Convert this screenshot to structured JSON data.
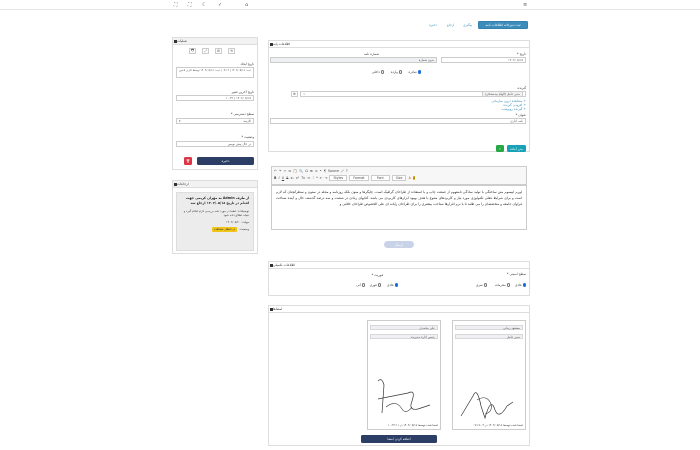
{
  "topbar": {
    "menu_icon": "≡",
    "icons": [
      "⛶",
      "⛶",
      "☾",
      "✓",
      "⌂"
    ]
  },
  "header": {
    "primary_button": "ثبت دبیرخانه اطلاعات نامه",
    "links": [
      "پیگیری",
      "ارجاع",
      "ذخیره"
    ]
  },
  "letter_info": {
    "title": "اطلاعات پایه",
    "date_label": "تاریخ *",
    "date_value": "۱۴۰۲/۰۵/۱۸",
    "number_label": "شماره نامه",
    "number_placeholder": "بدون شماره",
    "type_options": [
      "صادره",
      "وارده",
      "داخلی"
    ],
    "type_selected": 0,
    "recipient_label": "گیرنده",
    "recipient_value": "مدیر عامل (الهام بیدمشکی)",
    "recipient_links": [
      "مشاهده درون سازمانی +",
      "افزودن گیرنده +",
      "گیرنده رونوشت +"
    ],
    "subject_label": "عنوان *",
    "subject_value": "نامه اداری",
    "btn_template": "متن آماده",
    "btn_save_icon": "✓"
  },
  "editor": {
    "row1": [
      "↶",
      "↷",
      "✂",
      "⧉",
      "📋",
      "🔍",
      "Ω",
      "⊞",
      "≡",
      "•",
      "¶",
      "Source",
      "⤢",
      "?"
    ],
    "row2": [
      "B",
      "I",
      "U",
      "S",
      "x₂",
      "x²",
      "Tx",
      "≔",
      "⁝",
      "❝",
      "⇤",
      "⇥",
      "Styles",
      "Format",
      "Font",
      "Size",
      "A",
      "A"
    ],
    "body_text": "لورم ایپسوم متن ساختگی با تولید سادگی نامفهوم از صنعت چاپ و با استفاده از طراحان گرافیک است. چاپگرها و متون بلکه روزنامه و مجله در ستون و سطرآنچنان که لازم است و برای شرایط فعلی تکنولوژی مورد نیاز و کاربردهای متنوع با هدف بهبود ابزارهای کاربردی می باشد. کتابهای زیادی در شصت و سه درصد گذشته، حال و آینده شناخت فراوان جامعه و متخصصان را می طلبد تا با نرم افزارها شناخت بیشتری را برای طراحان رایانه ای علی الخصوص طراحان خلاقی و",
    "submit_disabled": "ارسال"
  },
  "more_info": {
    "title": "اطلاعات تکمیلی",
    "confidential_label": "سطح امنیتی *",
    "confidential_options": [
      "عادی",
      "محرمانه",
      "سری"
    ],
    "confidential_selected": 0,
    "priority_label": "فوریت *",
    "priority_options": [
      "عادی",
      "فوری",
      "آنی"
    ],
    "priority_selected": 0
  },
  "signatures": {
    "title": "امضاها",
    "cards": [
      {
        "name": "مسعود زمانی",
        "role": "مدیر عامل",
        "footer": "امضا شده توسط ۱۴۰۲/۰۵/۱۸ در ۰۹:۱۷:۰۳"
      },
      {
        "name": "علی محمدی",
        "role": "رئیس اداره مدیریت",
        "footer": "امضا شده توسط ۱۴۰۲/۰۵/۱۸ در ۱۰:۲۲:۱۱"
      }
    ],
    "add_button": "اضافه کردن امضا"
  },
  "side_actions": {
    "title": "عملیات",
    "icon_buttons": [
      "⟲",
      "⚙",
      "⤢",
      "🖶"
    ],
    "created_label": "تاریخ ایجاد",
    "created_value": "ثبت: ۱۴۰۲/۰۵/۱۸ | ۰۹:۱۲ | ثبت: ۱۴۰۲/۰۵/۱۸ توسط کاربر ادمین",
    "modified_label": "تاریخ آخرین تغییر",
    "modified_value": "۱۴۰۲/۰۵/۱۸ | ۱۰:۲۲",
    "access_label": "سطح دسترسی *",
    "access_value": "کارمند",
    "status_label": "وضعیت *",
    "status_value": "در حال پیش نویس",
    "save_button": "ذخیره",
    "delete_icon": "🗑"
  },
  "side_referrals": {
    "title": "ارجاعات",
    "notice_bold": "از طرف Admin به مهران کریمی جهت اقدام در تاریخ ۱۴۰۲/۰۵/۱۸ ارجاع شد",
    "notice_text": "توضیحات: لطفا در مورد نامه بررسی لازم انجام گیرد و نتیجه اطلاع داده شود",
    "deadline": "مهلت: ۱۴۰۲/۰۵/۲۰",
    "state_label": "وضعیت:",
    "state_badge": "در انتظار مشاهده"
  }
}
